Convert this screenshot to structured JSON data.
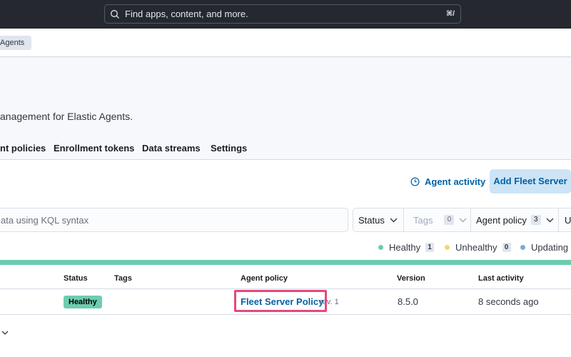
{
  "header": {
    "search_placeholder": "Find apps, content, and more.",
    "search_shortcut": "⌘/"
  },
  "breadcrumb": {
    "current": "Agents"
  },
  "page": {
    "description": "anagement for Elastic Agents.",
    "tabs": [
      "nt policies",
      "Enrollment tokens",
      "Data streams",
      "Settings"
    ]
  },
  "actions": {
    "agent_activity": "Agent activity",
    "add_fleet_server": "Add Fleet Server"
  },
  "filters": {
    "kql_placeholder": "ata using KQL syntax",
    "status_label": "Status",
    "tags_label": "Tags",
    "tags_count": "0",
    "agent_policy_label": "Agent policy",
    "agent_policy_count": "3",
    "next_label": "U"
  },
  "status_legend": [
    {
      "label": "Healthy",
      "count": "1",
      "color": "#6dccb1"
    },
    {
      "label": "Unhealthy",
      "count": "0",
      "color": "#f1d86f"
    },
    {
      "label": "Updating",
      "count": "",
      "color": "#79aad9"
    }
  ],
  "table": {
    "columns": [
      "Status",
      "Tags",
      "Agent policy",
      "Version",
      "Last activity"
    ],
    "rows": [
      {
        "status": "Healthy",
        "tags": "",
        "agent_policy": "Fleet Server Policy",
        "policy_rev": "rev. 1",
        "version": "8.5.0",
        "last_activity": "8 seconds ago"
      }
    ]
  },
  "colors": {
    "accent": "#0061a6",
    "healthy": "#6dccb1",
    "highlight": "#e5487d",
    "topbar": "#25282f"
  }
}
